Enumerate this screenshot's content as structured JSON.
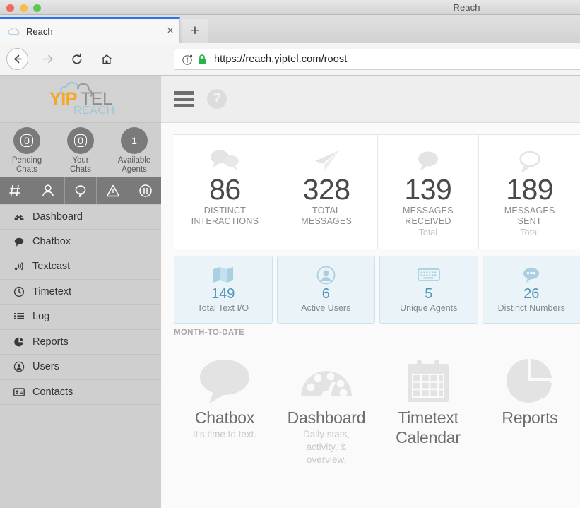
{
  "window": {
    "title": "Reach"
  },
  "browser": {
    "tab": {
      "label": "Reach",
      "favicon": "cloud-icon",
      "close": "×"
    },
    "new_tab_label": "+",
    "nav": {
      "back": "back-arrow-icon",
      "forward": "forward-arrow-icon",
      "reload": "reload-icon",
      "home": "home-icon"
    },
    "omnibox": {
      "url": "https://reach.yiptel.com/roost",
      "info_icon": "info-icon",
      "lock_icon": "lock-icon",
      "lock_color": "#2bb24c"
    }
  },
  "sidebar": {
    "logo": {
      "part1": "Y",
      "part2": "IP",
      "part3": "TEL",
      "tagline": "REACH",
      "color_orange": "#f5a623",
      "color_gray": "#8e8e8e",
      "color_blue": "#9fc6d8"
    },
    "stats": [
      {
        "value": "0",
        "label_line1": "Pending",
        "label_line2": "Chats"
      },
      {
        "value": "0",
        "label_line1": "Your",
        "label_line2": "Chats"
      },
      {
        "value": "1",
        "label_line1": "Available",
        "label_line2": "Agents"
      }
    ],
    "icon_bar": [
      {
        "name": "hash-icon"
      },
      {
        "name": "person-icon"
      },
      {
        "name": "chat-bubble-icon"
      },
      {
        "name": "warning-triangle-icon"
      },
      {
        "name": "pause-circle-icon"
      }
    ],
    "nav_items": [
      {
        "label": "Dashboard",
        "icon": "dashboard-gauge-icon"
      },
      {
        "label": "Chatbox",
        "icon": "chat-bubble-icon"
      },
      {
        "label": "Textcast",
        "icon": "broadcast-icon"
      },
      {
        "label": "Timetext",
        "icon": "clock-icon"
      },
      {
        "label": "Log",
        "icon": "list-icon"
      },
      {
        "label": "Reports",
        "icon": "pie-chart-icon"
      },
      {
        "label": "Users",
        "icon": "user-circle-icon"
      },
      {
        "label": "Contacts",
        "icon": "contact-card-icon"
      }
    ]
  },
  "main": {
    "topbar": {
      "menu_icon": "hamburger-menu-icon",
      "help_icon": "help-icon",
      "help_glyph": "?"
    },
    "stat_cards": [
      {
        "value": "86",
        "label": "DISTINCT\nINTERACTIONS",
        "label_line1": "DISTINCT",
        "label_line2": "INTERACTIONS",
        "sub": "",
        "icon": "two-chat-bubbles-icon"
      },
      {
        "value": "328",
        "label": "TOTAL\nMESSAGES",
        "label_line1": "TOTAL",
        "label_line2": "MESSAGES",
        "sub": "",
        "icon": "paper-plane-icon"
      },
      {
        "value": "139",
        "label": "MESSAGES\nRECEIVED",
        "label_line1": "MESSAGES",
        "label_line2": "RECEIVED",
        "sub": "Total",
        "icon": "filled-chat-bubble-icon"
      },
      {
        "value": "189",
        "label": "MESSAGES\nSENT",
        "label_line1": "MESSAGES",
        "label_line2": "SENT",
        "sub": "Total",
        "icon": "outline-chat-bubble-icon"
      }
    ],
    "mini_cards": [
      {
        "value": "149",
        "label": "Total Text I/O",
        "icon": "folded-map-icon"
      },
      {
        "value": "6",
        "label": "Active Users",
        "icon": "user-avatar-icon"
      },
      {
        "value": "5",
        "label": "Unique Agents",
        "icon": "keyboard-icon"
      },
      {
        "value": "26",
        "label": "Distinct Numbers",
        "icon": "chat-dots-icon"
      }
    ],
    "section_label": "MONTH-TO-DATE",
    "tiles": [
      {
        "title": "Chatbox",
        "subtitle": "It's time to text.",
        "icon": "speech-bubble-icon"
      },
      {
        "title": "Dashboard",
        "subtitle": "Daily stats, activity, & overview.",
        "icon": "gauge-icon"
      },
      {
        "title": "Timetext Calendar",
        "subtitle": "",
        "icon": "calendar-icon"
      },
      {
        "title": "Reports",
        "subtitle": "",
        "icon": "pie-chart-icon"
      }
    ]
  }
}
